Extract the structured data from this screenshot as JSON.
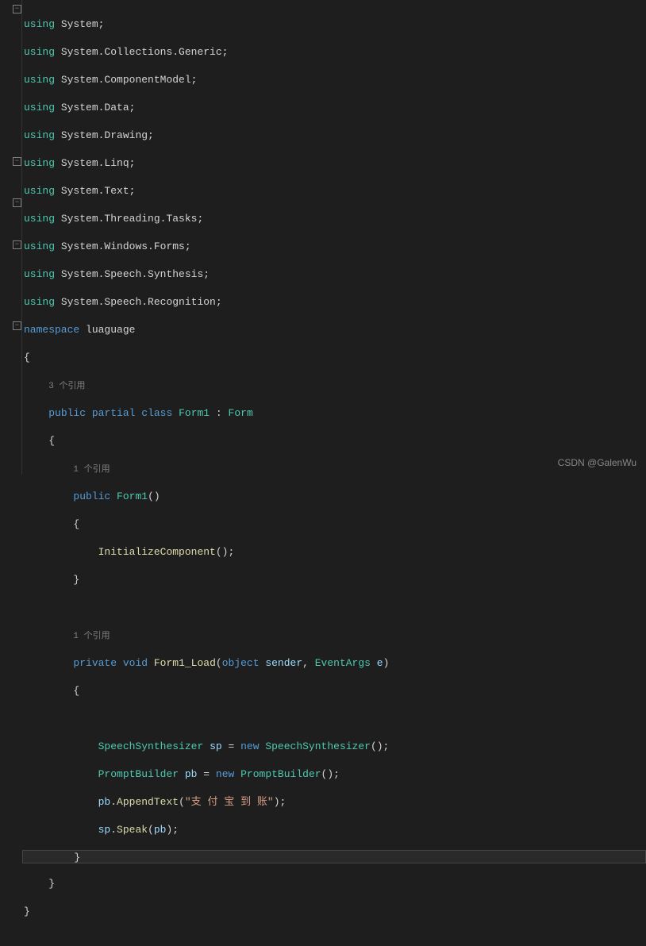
{
  "usings": [
    "System",
    "System.Collections.Generic",
    "System.ComponentModel",
    "System.Data",
    "System.Drawing",
    "System.Linq",
    "System.Text",
    "System.Threading.Tasks",
    "System.Windows.Forms",
    "System.Speech.Synthesis",
    "System.Speech.Recognition"
  ],
  "keywords": {
    "using": "using",
    "namespace": "namespace",
    "public": "public",
    "partial": "partial",
    "class": "class",
    "private": "private",
    "void": "void",
    "new": "new",
    "object": "object"
  },
  "ns": "luaguage",
  "class_name": "Form1",
  "base_class": "Form",
  "ctor_name": "Form1",
  "init_call": "InitializeComponent",
  "load_method": "Form1_Load",
  "load_params": {
    "sender": "sender",
    "eventargs_type": "EventArgs",
    "e": "e"
  },
  "codelens": {
    "refs3": "3 个引用",
    "refs1a": "1 个引用",
    "refs1b": "1 个引用"
  },
  "body": {
    "sp_type": "SpeechSynthesizer",
    "sp_var": "sp",
    "pb_type": "PromptBuilder",
    "pb_var": "pb",
    "append_method": "AppendText",
    "append_text": "\"支 付 宝 到 账\"",
    "speak_method": "Speak"
  },
  "watermark": "CSDN @GalenWu"
}
